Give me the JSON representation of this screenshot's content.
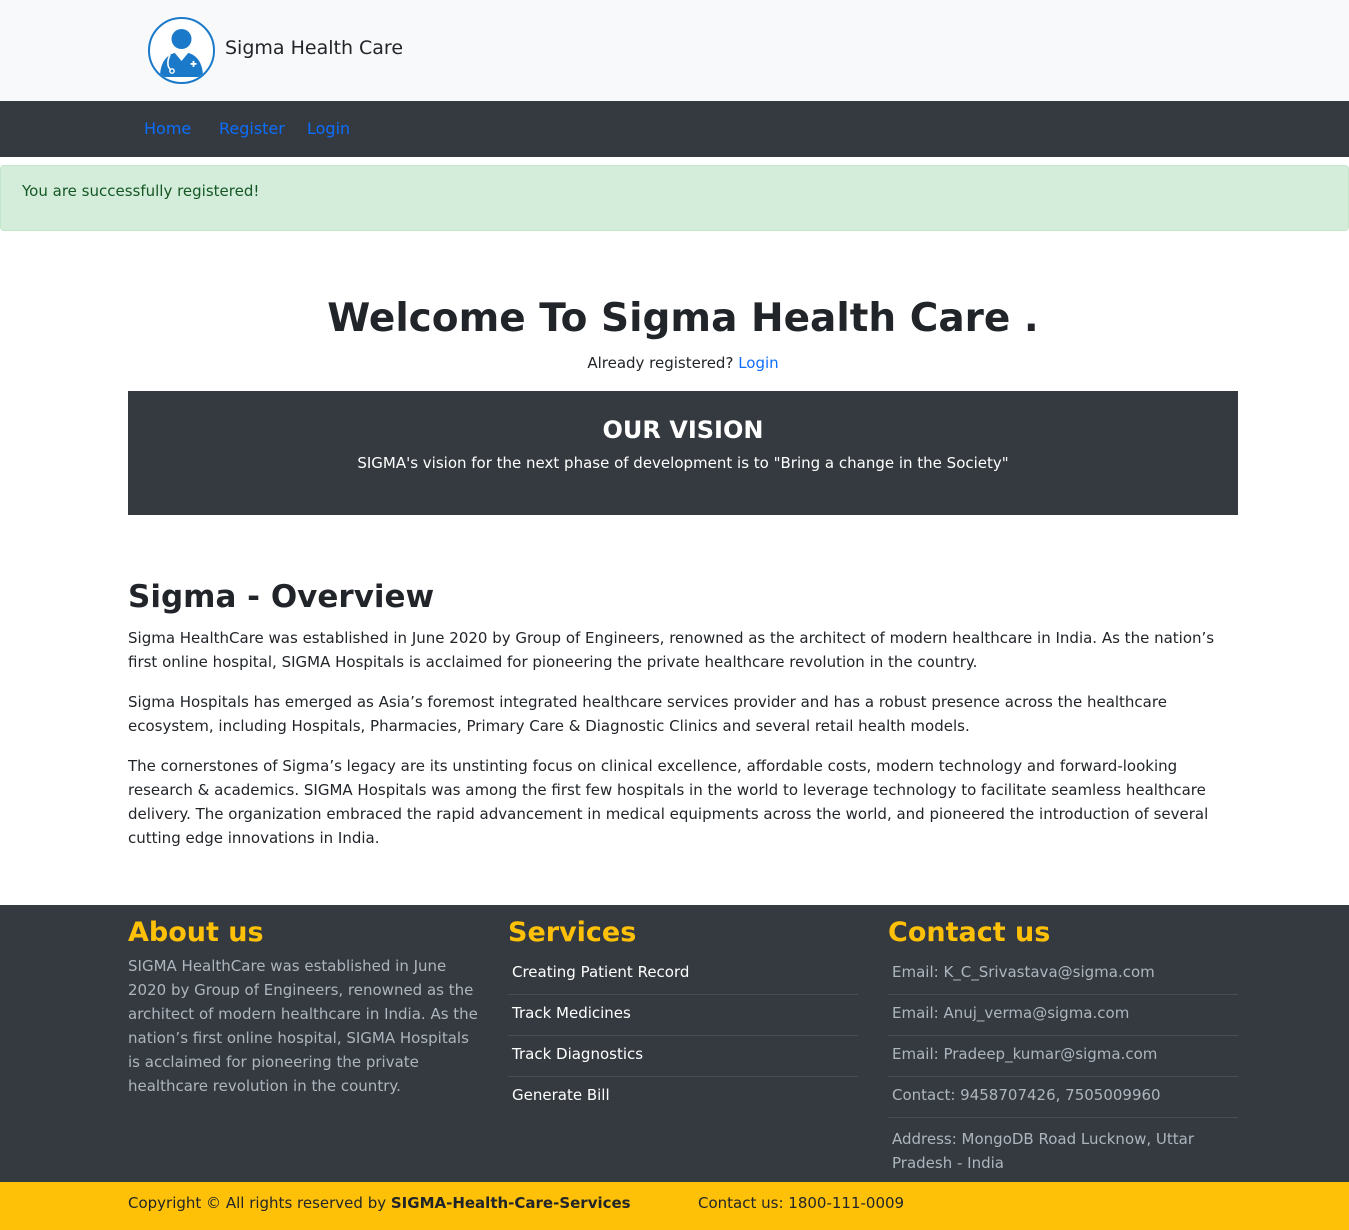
{
  "header": {
    "brand_name": "Sigma Health Care",
    "logo_icon": "doctor-avatar-icon",
    "brand_color": "#1a7ac9"
  },
  "nav": {
    "items": [
      {
        "label": "Home"
      },
      {
        "label": "Register"
      },
      {
        "label": "Login"
      }
    ],
    "link_color": "#0d6efd",
    "bar_color": "#343a40"
  },
  "alert": {
    "message": "You are successfully registered!",
    "type": "success"
  },
  "hero": {
    "title": "Welcome To Sigma Health Care .",
    "already_text": "Already registered?",
    "login_link": "Login"
  },
  "vision": {
    "title": "OUR VISION",
    "text": "SIGMA's vision for the next phase of development is to \"Bring a change in the Society\""
  },
  "overview": {
    "title": "Sigma - Overview",
    "paragraphs": [
      "Sigma HealthCare was established in June 2020 by Group of Engineers, renowned as the architect of modern healthcare in India. As the nation’s first online hospital, SIGMA Hospitals is acclaimed for pioneering the private healthcare revolution in the country.",
      "Sigma Hospitals has emerged as Asia’s foremost integrated healthcare services provider and has a robust presence across the healthcare ecosystem, including Hospitals, Pharmacies, Primary Care & Diagnostic Clinics and several retail health models.",
      "The cornerstones of Sigma’s legacy are its unstinting focus on clinical excellence, affordable costs, modern technology and forward-looking research & academics. SIGMA Hospitals was among the first few hospitals in the world to leverage technology to facilitate seamless healthcare delivery. The organization embraced the rapid advancement in medical equipments across the world, and pioneered the introduction of several cutting edge innovations in India."
    ]
  },
  "footer": {
    "heading_color": "#ffc107",
    "about": {
      "title": "About us",
      "text": "SIGMA HealthCare was established in June 2020 by Group of Engineers, renowned as the architect of modern healthcare in India. As the nation’s first online hospital, SIGMA Hospitals is acclaimed for pioneering the private healthcare revolution in the country."
    },
    "services": {
      "title": "Services",
      "items": [
        "Creating Patient Record",
        "Track Medicines",
        "Track Diagnostics",
        "Generate Bill"
      ]
    },
    "contact": {
      "title": "Contact us",
      "items": [
        "Email: K_C_Srivastava@sigma.com",
        "Email: Anuj_verma@sigma.com",
        "Email: Pradeep_kumar@sigma.com",
        "Contact: 9458707426, 7505009960",
        "Address: MongoDB Road Lucknow, Uttar Pradesh - India"
      ]
    }
  },
  "copyright": {
    "prefix": "Copyright © All rights reserved by",
    "company": "SIGMA-Health-Care-Services",
    "contact": "Contact us: 1800-111-0009",
    "bar_color": "#ffc107"
  }
}
